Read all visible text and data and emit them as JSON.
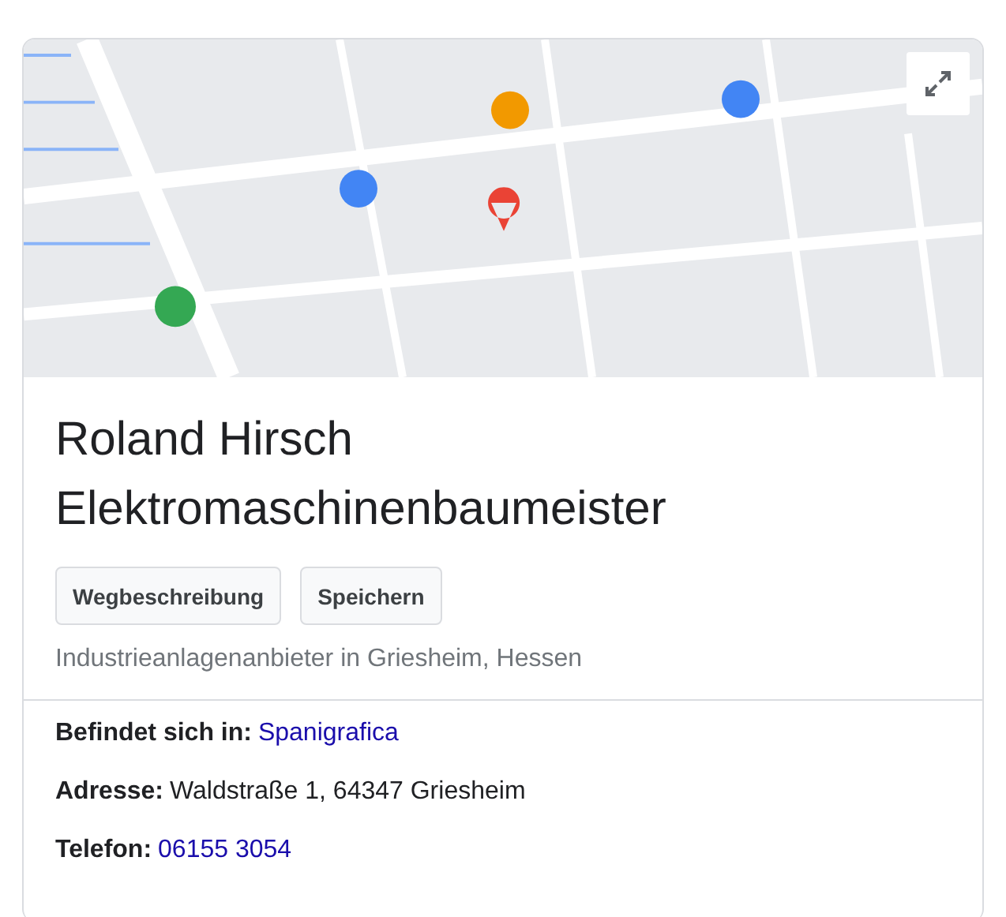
{
  "map": {
    "kind": "picture"
  },
  "title": [
    "Roland Hirsch",
    "Elektromaschinenbaumeister"
  ],
  "buttons": [
    "Wegbeschreibung",
    "Speichern"
  ],
  "category": "Industrieanlagenanbieter in Griesheim, Hessen",
  "facts": [
    {
      "label": "Befindet sich in:",
      "value": "Spanigrafica",
      "kind": "link"
    },
    {
      "label": "Adresse:",
      "value": "Waldstraße 1, 64347 Griesheim",
      "kind": "text"
    },
    {
      "label": "Telefon:",
      "value": "06155 3054",
      "kind": "link"
    }
  ]
}
